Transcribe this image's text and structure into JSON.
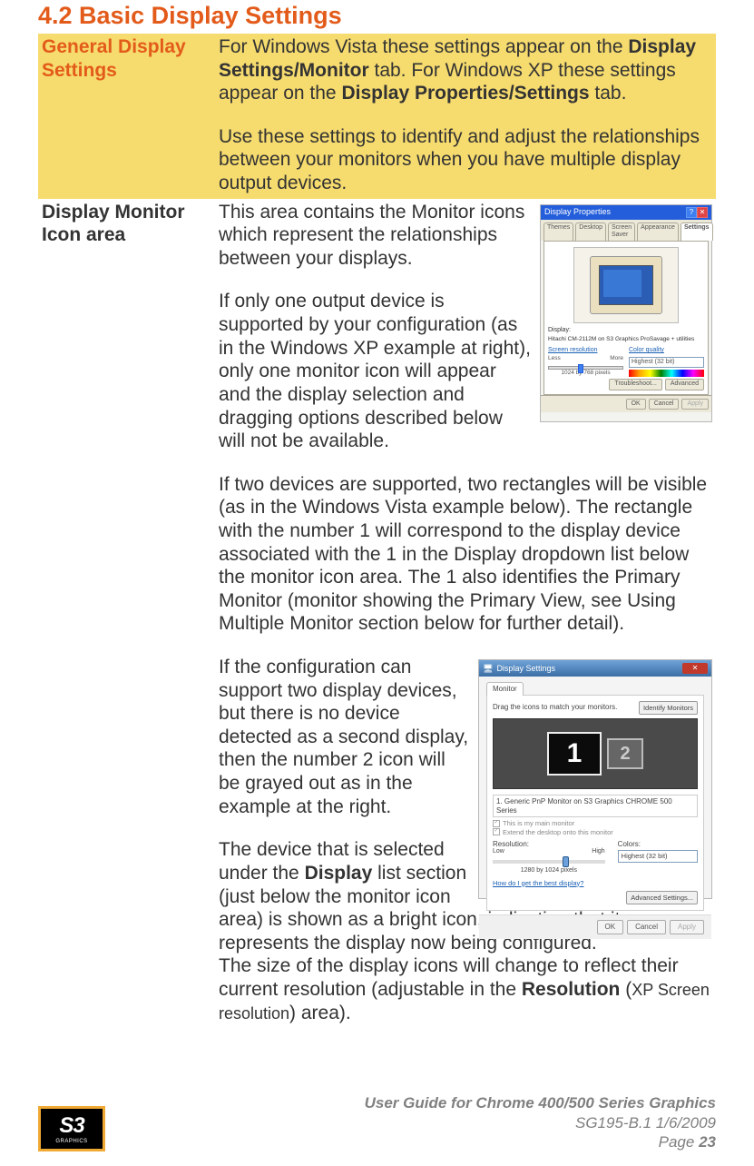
{
  "heading": "4.2   Basic Display Settings",
  "rows": {
    "general": {
      "label": "General Display Settings",
      "p1_pre": "For Windows Vista these settings appear on the ",
      "p1_b1": "Display Settings/Monitor",
      "p1_mid": " tab. For Windows XP these settings appear on the ",
      "p1_b2": "Display Properties/Settings",
      "p1_post": " tab.",
      "p2": "Use these settings to identify and adjust the relationships between your monitors when you have multiple display output devices."
    },
    "monitorIcon": {
      "label": "Display Monitor Icon area",
      "p1": "This area contains the Monitor icons which represent the relationships between your displays.",
      "p2": "If only one output device is supported by your configuration (as in the Windows XP example at right), only one monitor icon will appear and the display selection and dragging options described below will not be available.",
      "p3": "If two devices are supported, two rectangles will be visible (as in the Windows Vista example below). The rectangle with the number 1 will correspond to the display device associated with the 1 in the Display dropdown list below the monitor icon area. The 1 also identifies the Primary Monitor (monitor showing the Primary View, see Using Multiple Monitor section below for further detail).",
      "p4": "If the configuration can support two display devices, but there is no device detected as a second display, then the number 2 icon will be grayed out as in the example at the right.",
      "p5_pre": "The device that is selected under the ",
      "p5_b1": "Display",
      "p5_post": " list section (just below the monitor icon area) is shown as a bright icon, indicating that it represents the display now being configured.",
      "p6_pre": "The size of the display icons will change to reflect their current resolution (adjustable in the ",
      "p6_b1": "Resolution",
      "p6_mid": " (",
      "p6_small": "XP Screen resolution",
      "p6_post": ") area)."
    }
  },
  "xp": {
    "title": "Display Properties",
    "tabs": [
      "Themes",
      "Desktop",
      "Screen Saver",
      "Appearance",
      "Settings"
    ],
    "displayLabel": "Display:",
    "displayValue": "Hitachi CM-2112M on S3 Graphics ProSavage + utilities",
    "screenResLabel": "Screen resolution",
    "less": "Less",
    "more": "More",
    "resValue": "1024 by 768 pixels",
    "colorLabel": "Color quality",
    "colorValue": "Highest (32 bit)",
    "troubleshoot": "Troubleshoot...",
    "advanced": "Advanced",
    "ok": "OK",
    "cancel": "Cancel",
    "apply": "Apply"
  },
  "vista": {
    "title": "Display Settings",
    "tab": "Monitor",
    "dragText": "Drag the icons to match your monitors.",
    "identify": "Identify Monitors",
    "mon1": "1",
    "mon2": "2",
    "deviceLabel": "1. Generic PnP Monitor on S3 Graphics CHROME 500 Series",
    "chkMain": "This is my main monitor",
    "chkExtend": "Extend the desktop onto this monitor",
    "resLabel": "Resolution:",
    "low": "Low",
    "high": "High",
    "resVal": "1280 by 1024 pixels",
    "colorsLabel": "Colors:",
    "colorsVal": "Highest (32 bit)",
    "helpLink": "How do I get the best display?",
    "advanced": "Advanced Settings...",
    "ok": "OK",
    "cancel": "Cancel",
    "apply": "Apply"
  },
  "footer": {
    "line1": "User Guide for Chrome 400/500 Series Graphics",
    "line2": "SG195-B.1   1/6/2009",
    "pageLabel": "Page ",
    "pageNum": "23"
  },
  "logo": {
    "main": "S3",
    "sub": "GRAPHICS"
  }
}
